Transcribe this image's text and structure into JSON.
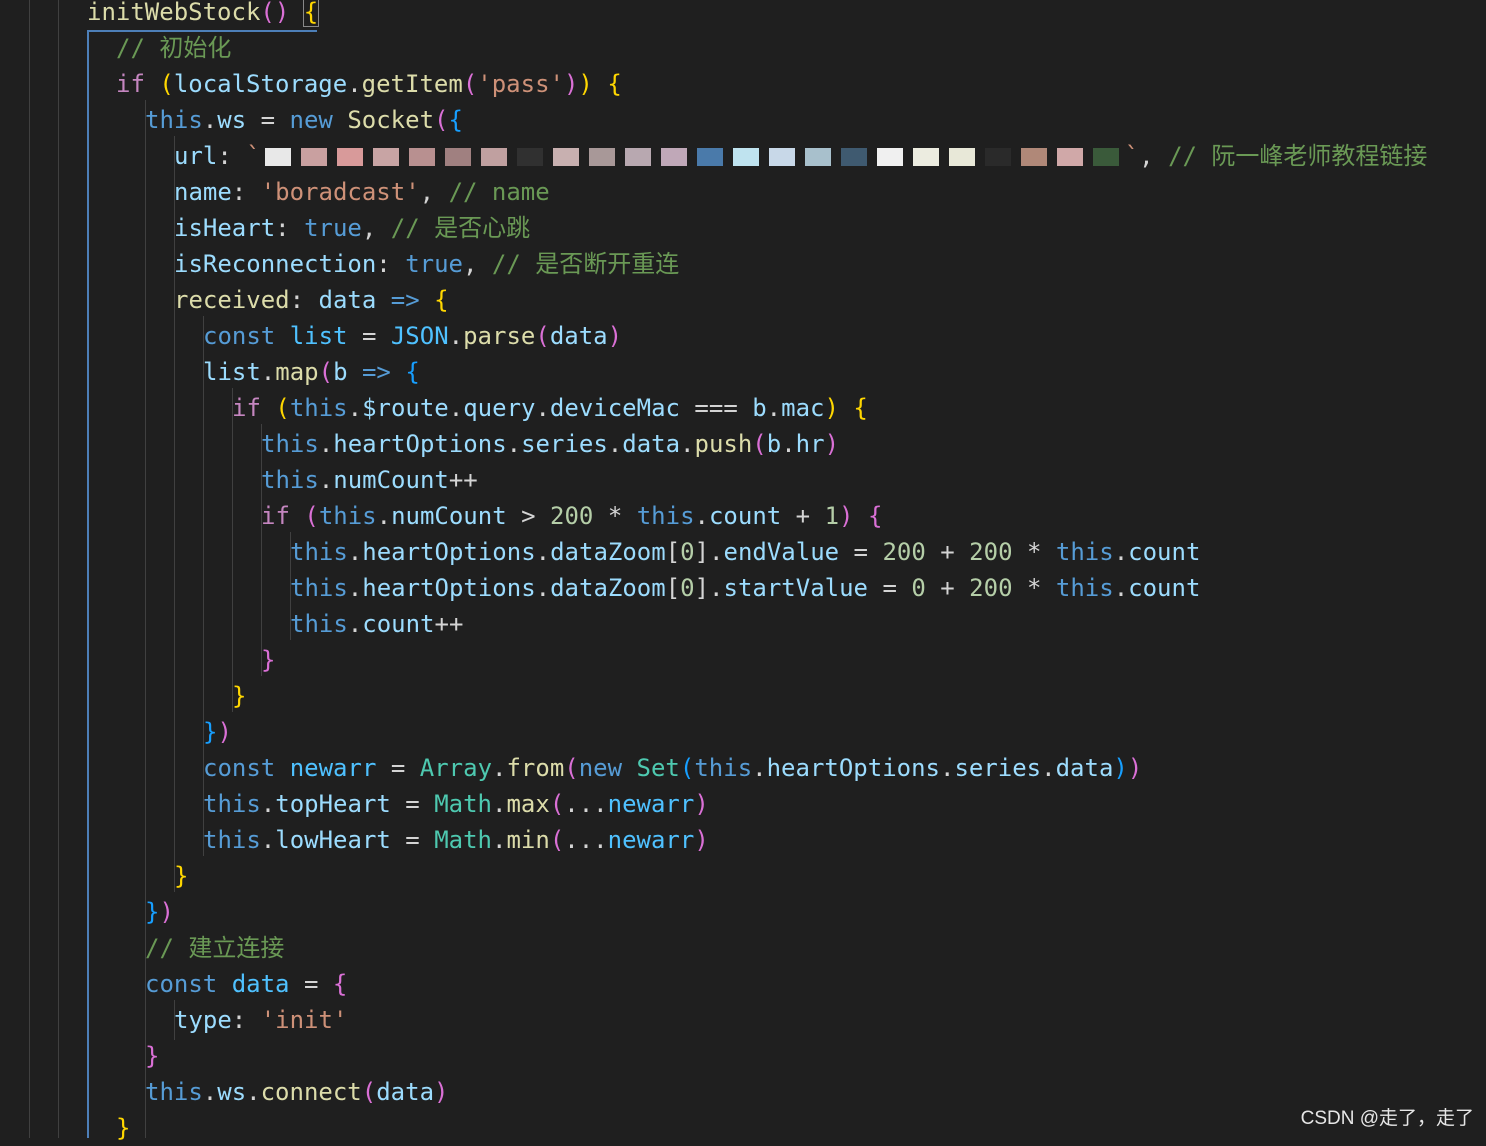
{
  "code_lines": [
    {
      "indent": 3,
      "tokens": [
        [
          "fn",
          "initWebStock"
        ],
        [
          "b2",
          "()"
        ],
        [
          "pun",
          " "
        ],
        [
          "b1",
          "{"
        ]
      ]
    },
    {
      "indent": 4,
      "tokens": [
        [
          "com",
          "// 初始化"
        ]
      ]
    },
    {
      "indent": 4,
      "tokens": [
        [
          "ctl",
          "if"
        ],
        [
          "pun",
          " "
        ],
        [
          "b1",
          "("
        ],
        [
          "var",
          "localStorage"
        ],
        [
          "pun",
          "."
        ],
        [
          "fn",
          "getItem"
        ],
        [
          "b2",
          "("
        ],
        [
          "str",
          "'pass'"
        ],
        [
          "b2",
          ")"
        ],
        [
          "b1",
          ")"
        ],
        [
          "pun",
          " "
        ],
        [
          "b1",
          "{"
        ]
      ]
    },
    {
      "indent": 5,
      "tokens": [
        [
          "kw",
          "this"
        ],
        [
          "pun",
          "."
        ],
        [
          "var",
          "ws"
        ],
        [
          "pun",
          " = "
        ],
        [
          "kw",
          "new"
        ],
        [
          "pun",
          " "
        ],
        [
          "fn",
          "Socket"
        ],
        [
          "b2",
          "("
        ],
        [
          "b3",
          "{"
        ]
      ]
    },
    {
      "indent": 6,
      "tokens": [
        [
          "var",
          "url"
        ],
        [
          "pun",
          ": "
        ],
        [
          "str",
          "`"
        ],
        [
          "blur",
          ""
        ],
        [
          "str",
          "`"
        ],
        [
          "pun",
          ", "
        ],
        [
          "com",
          "// 阮一峰老师教程链接"
        ]
      ]
    },
    {
      "indent": 6,
      "tokens": [
        [
          "var",
          "name"
        ],
        [
          "pun",
          ": "
        ],
        [
          "str",
          "'boradcast'"
        ],
        [
          "pun",
          ", "
        ],
        [
          "com",
          "// name"
        ]
      ]
    },
    {
      "indent": 6,
      "tokens": [
        [
          "var",
          "isHeart"
        ],
        [
          "pun",
          ": "
        ],
        [
          "kw",
          "true"
        ],
        [
          "pun",
          ", "
        ],
        [
          "com",
          "// 是否心跳"
        ]
      ]
    },
    {
      "indent": 6,
      "tokens": [
        [
          "var",
          "isReconnection"
        ],
        [
          "pun",
          ": "
        ],
        [
          "kw",
          "true"
        ],
        [
          "pun",
          ", "
        ],
        [
          "com",
          "// 是否断开重连"
        ]
      ]
    },
    {
      "indent": 6,
      "tokens": [
        [
          "fn",
          "received"
        ],
        [
          "pun",
          ": "
        ],
        [
          "var",
          "data"
        ],
        [
          "pun",
          " "
        ],
        [
          "kw",
          "=>"
        ],
        [
          "pun",
          " "
        ],
        [
          "b1",
          "{"
        ]
      ]
    },
    {
      "indent": 7,
      "tokens": [
        [
          "kw",
          "const"
        ],
        [
          "pun",
          " "
        ],
        [
          "const",
          "list"
        ],
        [
          "pun",
          " = "
        ],
        [
          "const",
          "JSON"
        ],
        [
          "pun",
          "."
        ],
        [
          "fn",
          "parse"
        ],
        [
          "b2",
          "("
        ],
        [
          "var",
          "data"
        ],
        [
          "b2",
          ")"
        ]
      ]
    },
    {
      "indent": 7,
      "tokens": [
        [
          "var",
          "list"
        ],
        [
          "pun",
          "."
        ],
        [
          "fn",
          "map"
        ],
        [
          "b2",
          "("
        ],
        [
          "var",
          "b"
        ],
        [
          "pun",
          " "
        ],
        [
          "kw",
          "=>"
        ],
        [
          "pun",
          " "
        ],
        [
          "b3",
          "{"
        ]
      ]
    },
    {
      "indent": 8,
      "tokens": [
        [
          "ctl",
          "if"
        ],
        [
          "pun",
          " "
        ],
        [
          "b1",
          "("
        ],
        [
          "kw",
          "this"
        ],
        [
          "pun",
          "."
        ],
        [
          "var",
          "$route"
        ],
        [
          "pun",
          "."
        ],
        [
          "var",
          "query"
        ],
        [
          "pun",
          "."
        ],
        [
          "var",
          "deviceMac"
        ],
        [
          "pun",
          " === "
        ],
        [
          "var",
          "b"
        ],
        [
          "pun",
          "."
        ],
        [
          "var",
          "mac"
        ],
        [
          "b1",
          ")"
        ],
        [
          "pun",
          " "
        ],
        [
          "b1",
          "{"
        ]
      ]
    },
    {
      "indent": 9,
      "tokens": [
        [
          "kw",
          "this"
        ],
        [
          "pun",
          "."
        ],
        [
          "var",
          "heartOptions"
        ],
        [
          "pun",
          "."
        ],
        [
          "var",
          "series"
        ],
        [
          "pun",
          "."
        ],
        [
          "var",
          "data"
        ],
        [
          "pun",
          "."
        ],
        [
          "fn",
          "push"
        ],
        [
          "b2",
          "("
        ],
        [
          "var",
          "b"
        ],
        [
          "pun",
          "."
        ],
        [
          "var",
          "hr"
        ],
        [
          "b2",
          ")"
        ]
      ]
    },
    {
      "indent": 9,
      "tokens": [
        [
          "kw",
          "this"
        ],
        [
          "pun",
          "."
        ],
        [
          "var",
          "numCount"
        ],
        [
          "pun",
          "++"
        ]
      ]
    },
    {
      "indent": 9,
      "tokens": [
        [
          "ctl",
          "if"
        ],
        [
          "pun",
          " "
        ],
        [
          "b2",
          "("
        ],
        [
          "kw",
          "this"
        ],
        [
          "pun",
          "."
        ],
        [
          "var",
          "numCount"
        ],
        [
          "pun",
          " > "
        ],
        [
          "num",
          "200"
        ],
        [
          "pun",
          " * "
        ],
        [
          "kw",
          "this"
        ],
        [
          "pun",
          "."
        ],
        [
          "var",
          "count"
        ],
        [
          "pun",
          " + "
        ],
        [
          "num",
          "1"
        ],
        [
          "b2",
          ")"
        ],
        [
          "pun",
          " "
        ],
        [
          "b2",
          "{"
        ]
      ]
    },
    {
      "indent": 10,
      "tokens": [
        [
          "kw",
          "this"
        ],
        [
          "pun",
          "."
        ],
        [
          "var",
          "heartOptions"
        ],
        [
          "pun",
          "."
        ],
        [
          "var",
          "dataZoom"
        ],
        [
          "pun",
          "["
        ],
        [
          "num",
          "0"
        ],
        [
          "pun",
          "]."
        ],
        [
          "var",
          "endValue"
        ],
        [
          "pun",
          " = "
        ],
        [
          "num",
          "200"
        ],
        [
          "pun",
          " + "
        ],
        [
          "num",
          "200"
        ],
        [
          "pun",
          " * "
        ],
        [
          "kw",
          "this"
        ],
        [
          "pun",
          "."
        ],
        [
          "var",
          "count"
        ]
      ]
    },
    {
      "indent": 10,
      "tokens": [
        [
          "kw",
          "this"
        ],
        [
          "pun",
          "."
        ],
        [
          "var",
          "heartOptions"
        ],
        [
          "pun",
          "."
        ],
        [
          "var",
          "dataZoom"
        ],
        [
          "pun",
          "["
        ],
        [
          "num",
          "0"
        ],
        [
          "pun",
          "]."
        ],
        [
          "var",
          "startValue"
        ],
        [
          "pun",
          " = "
        ],
        [
          "num",
          "0"
        ],
        [
          "pun",
          " + "
        ],
        [
          "num",
          "200"
        ],
        [
          "pun",
          " * "
        ],
        [
          "kw",
          "this"
        ],
        [
          "pun",
          "."
        ],
        [
          "var",
          "count"
        ]
      ]
    },
    {
      "indent": 10,
      "tokens": [
        [
          "kw",
          "this"
        ],
        [
          "pun",
          "."
        ],
        [
          "var",
          "count"
        ],
        [
          "pun",
          "++"
        ]
      ]
    },
    {
      "indent": 9,
      "tokens": [
        [
          "b2",
          "}"
        ]
      ]
    },
    {
      "indent": 8,
      "tokens": [
        [
          "b1",
          "}"
        ]
      ]
    },
    {
      "indent": 7,
      "tokens": [
        [
          "b3",
          "}"
        ],
        [
          "b2",
          ")"
        ]
      ]
    },
    {
      "indent": 7,
      "tokens": [
        [
          "kw",
          "const"
        ],
        [
          "pun",
          " "
        ],
        [
          "const",
          "newarr"
        ],
        [
          "pun",
          " = "
        ],
        [
          "cls",
          "Array"
        ],
        [
          "pun",
          "."
        ],
        [
          "fn",
          "from"
        ],
        [
          "b2",
          "("
        ],
        [
          "kw",
          "new"
        ],
        [
          "pun",
          " "
        ],
        [
          "cls",
          "Set"
        ],
        [
          "b3",
          "("
        ],
        [
          "kw",
          "this"
        ],
        [
          "pun",
          "."
        ],
        [
          "var",
          "heartOptions"
        ],
        [
          "pun",
          "."
        ],
        [
          "var",
          "series"
        ],
        [
          "pun",
          "."
        ],
        [
          "var",
          "data"
        ],
        [
          "b3",
          ")"
        ],
        [
          "b2",
          ")"
        ]
      ]
    },
    {
      "indent": 7,
      "tokens": [
        [
          "kw",
          "this"
        ],
        [
          "pun",
          "."
        ],
        [
          "var",
          "topHeart"
        ],
        [
          "pun",
          " = "
        ],
        [
          "cls",
          "Math"
        ],
        [
          "pun",
          "."
        ],
        [
          "fn",
          "max"
        ],
        [
          "b2",
          "("
        ],
        [
          "pun",
          "..."
        ],
        [
          "const",
          "newarr"
        ],
        [
          "b2",
          ")"
        ]
      ]
    },
    {
      "indent": 7,
      "tokens": [
        [
          "kw",
          "this"
        ],
        [
          "pun",
          "."
        ],
        [
          "var",
          "lowHeart"
        ],
        [
          "pun",
          " = "
        ],
        [
          "cls",
          "Math"
        ],
        [
          "pun",
          "."
        ],
        [
          "fn",
          "min"
        ],
        [
          "b2",
          "("
        ],
        [
          "pun",
          "..."
        ],
        [
          "const",
          "newarr"
        ],
        [
          "b2",
          ")"
        ]
      ]
    },
    {
      "indent": 6,
      "tokens": [
        [
          "b1",
          "}"
        ]
      ]
    },
    {
      "indent": 5,
      "tokens": [
        [
          "b3",
          "}"
        ],
        [
          "b2",
          ")"
        ]
      ]
    },
    {
      "indent": 5,
      "tokens": [
        [
          "com",
          "// 建立连接"
        ]
      ]
    },
    {
      "indent": 5,
      "tokens": [
        [
          "kw",
          "const"
        ],
        [
          "pun",
          " "
        ],
        [
          "const",
          "data"
        ],
        [
          "pun",
          " = "
        ],
        [
          "b2",
          "{"
        ]
      ]
    },
    {
      "indent": 6,
      "tokens": [
        [
          "var",
          "type"
        ],
        [
          "pun",
          ": "
        ],
        [
          "str",
          "'init'"
        ]
      ]
    },
    {
      "indent": 5,
      "tokens": [
        [
          "b2",
          "}"
        ]
      ]
    },
    {
      "indent": 5,
      "tokens": [
        [
          "kw",
          "this"
        ],
        [
          "pun",
          "."
        ],
        [
          "var",
          "ws"
        ],
        [
          "pun",
          "."
        ],
        [
          "fn",
          "connect"
        ],
        [
          "b2",
          "("
        ],
        [
          "var",
          "data"
        ],
        [
          "b2",
          ")"
        ]
      ]
    },
    {
      "indent": 4,
      "tokens": [
        [
          "b1",
          "}"
        ]
      ]
    }
  ],
  "redacted_colors": [
    "#e8e8e8",
    "#c9a0a0",
    "#d89a9a",
    "#c8a4a4",
    "#b89090",
    "#a08080",
    "#c0a0a0",
    "#303030",
    "#c8b0b0",
    "#a89898",
    "#b8a8b0",
    "#c0a8b8",
    "#4a7aaa",
    "#bfe3ef",
    "#c8d8e8",
    "#a8c0cc",
    "#3f5a70",
    "#f0f0f0",
    "#ecece0",
    "#e8e8d8",
    "#2a2a2a",
    "#b08878",
    "#d0a8a8",
    "#3a5a3a"
  ],
  "watermark": "CSDN @走了，走了"
}
